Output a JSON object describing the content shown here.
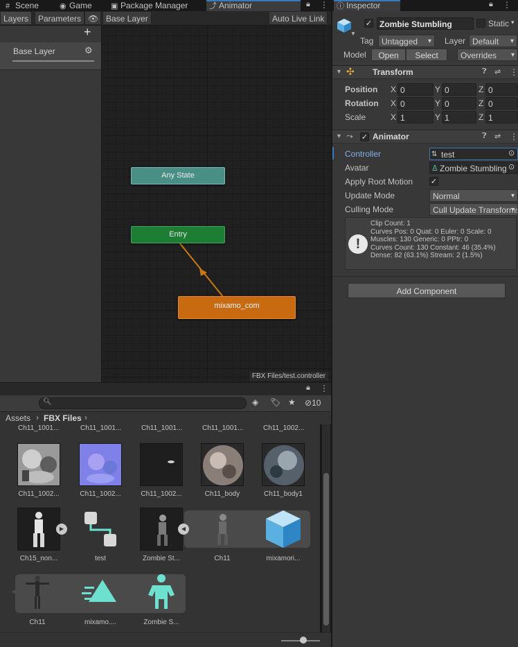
{
  "top_tabs": [
    {
      "label": "Scene",
      "icon": "scene-icon"
    },
    {
      "label": "Game",
      "icon": "game-icon"
    },
    {
      "label": "Package Manager",
      "icon": "package-icon"
    },
    {
      "label": "Animator",
      "icon": "animator-icon"
    }
  ],
  "animator": {
    "tabs": [
      "Layers",
      "Parameters"
    ],
    "breadcrumb": "Base Layer",
    "auto_live_link": "Auto Live Link",
    "layer_name": "Base Layer",
    "add_button": "+",
    "states": {
      "any": "Any State",
      "entry": "Entry",
      "default": "mixamo_com"
    },
    "footer_path": "FBX Files/test.controller"
  },
  "inspector": {
    "tab": "Inspector",
    "object_name": "Zombie Stumbling",
    "static_label": "Static",
    "tag_label": "Tag",
    "tag_value": "Untagged",
    "layer_label": "Layer",
    "layer_value": "Default",
    "model_label": "Model",
    "open_btn": "Open",
    "select_btn": "Select",
    "overrides": "Overrides",
    "transform": {
      "title": "Transform",
      "position_label": "Position",
      "rotation_label": "Rotation",
      "scale_label": "Scale",
      "axis": [
        "X",
        "Y",
        "Z"
      ],
      "position": [
        "0",
        "0",
        "0"
      ],
      "rotation": [
        "0",
        "0",
        "0"
      ],
      "scale": [
        "1",
        "1",
        "1"
      ]
    },
    "animator": {
      "title": "Animator",
      "controller_label": "Controller",
      "controller_value": "test",
      "avatar_label": "Avatar",
      "avatar_value": "Zombie Stumbling",
      "apply_root_label": "Apply Root Motion",
      "update_mode_label": "Update Mode",
      "update_mode_value": "Normal",
      "culling_label": "Culling Mode",
      "culling_value": "Cull Update Transforms",
      "info": [
        "Clip Count: 1",
        "Curves Pos: 0 Quat: 0 Euler: 0 Scale: 0",
        "Muscles: 130 Generic: 0 PPtr: 0",
        "Curves Count: 130 Constant: 46 (35.4%)",
        "Dense: 82 (63.1%) Stream: 2 (1.5%)"
      ]
    },
    "add_component": "Add Component"
  },
  "project": {
    "search_placeholder": "",
    "hidden_count": "10",
    "breadcrumb_root": "Assets",
    "breadcrumb_folder": "FBX Files",
    "top_row_labels": [
      "Ch11_1001...",
      "Ch11_1001...",
      "Ch11_1001...",
      "Ch11_1001...",
      "Ch11_1002..."
    ],
    "row1": [
      "Ch11_1002...",
      "Ch11_1002...",
      "Ch11_1002...",
      "Ch11_body",
      "Ch11_body1"
    ],
    "row2": [
      "Ch15_non...",
      "test",
      "Zombie St...",
      "Ch11",
      "mixamori..."
    ],
    "row3": [
      "Ch11",
      "mixamo....",
      "Zombie S..."
    ]
  },
  "colors": {
    "accent": "#3a79bb",
    "any_state": "#4a8f86",
    "entry": "#1e7d34",
    "default_state": "#c86a10",
    "avatar_icon": "#6ee0d0"
  }
}
